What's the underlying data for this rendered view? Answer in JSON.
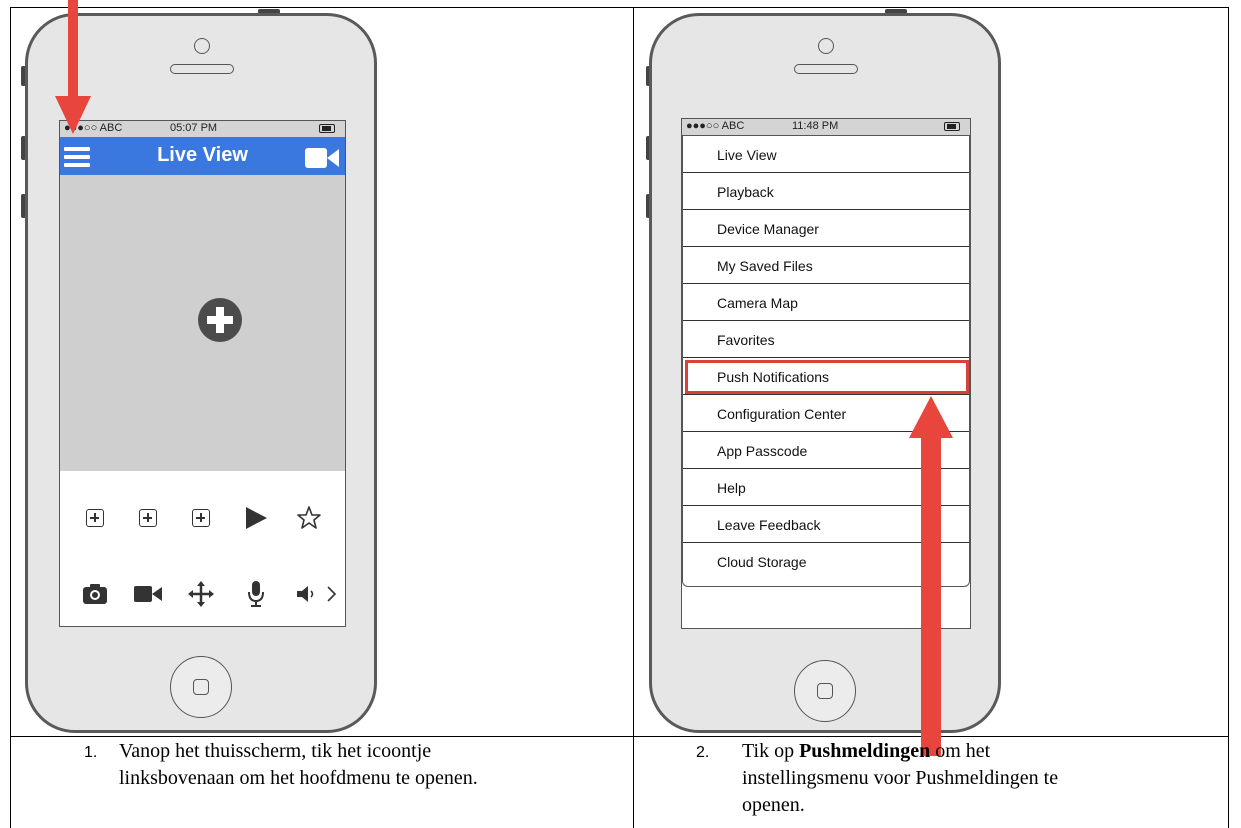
{
  "step1": {
    "status": {
      "carrier": "●●●○○ ABC",
      "time": "05:07 PM"
    },
    "nav": {
      "title": "Live View"
    },
    "caption": {
      "number": "1.",
      "line1": "Vanop het thuisscherm, tik het icoontje",
      "line2": "linksbovenaan om het hoofdmenu te openen."
    }
  },
  "step2": {
    "status": {
      "carrier": "●●●○○ ABC",
      "time": "11:48 PM"
    },
    "menu_items": [
      "Live View",
      "Playback",
      "Device Manager",
      "My Saved Files",
      "Camera Map",
      "Favorites",
      "Push Notifications",
      "Configuration Center",
      "App Passcode",
      "Help",
      "Leave Feedback",
      "Cloud Storage"
    ],
    "highlighted_item": "Push Notifications",
    "caption": {
      "number": "2.",
      "line1_prefix": "Tik op ",
      "line1_bold": "Pushmeldingen",
      "line1_suffix": " om het",
      "line2": "instellingsmenu voor Pushmeldingen te",
      "line3": "openen."
    }
  },
  "colors": {
    "accent_blue": "#3a78e0",
    "arrow_red": "#e8453c",
    "highlight_red": "#d9413a"
  }
}
